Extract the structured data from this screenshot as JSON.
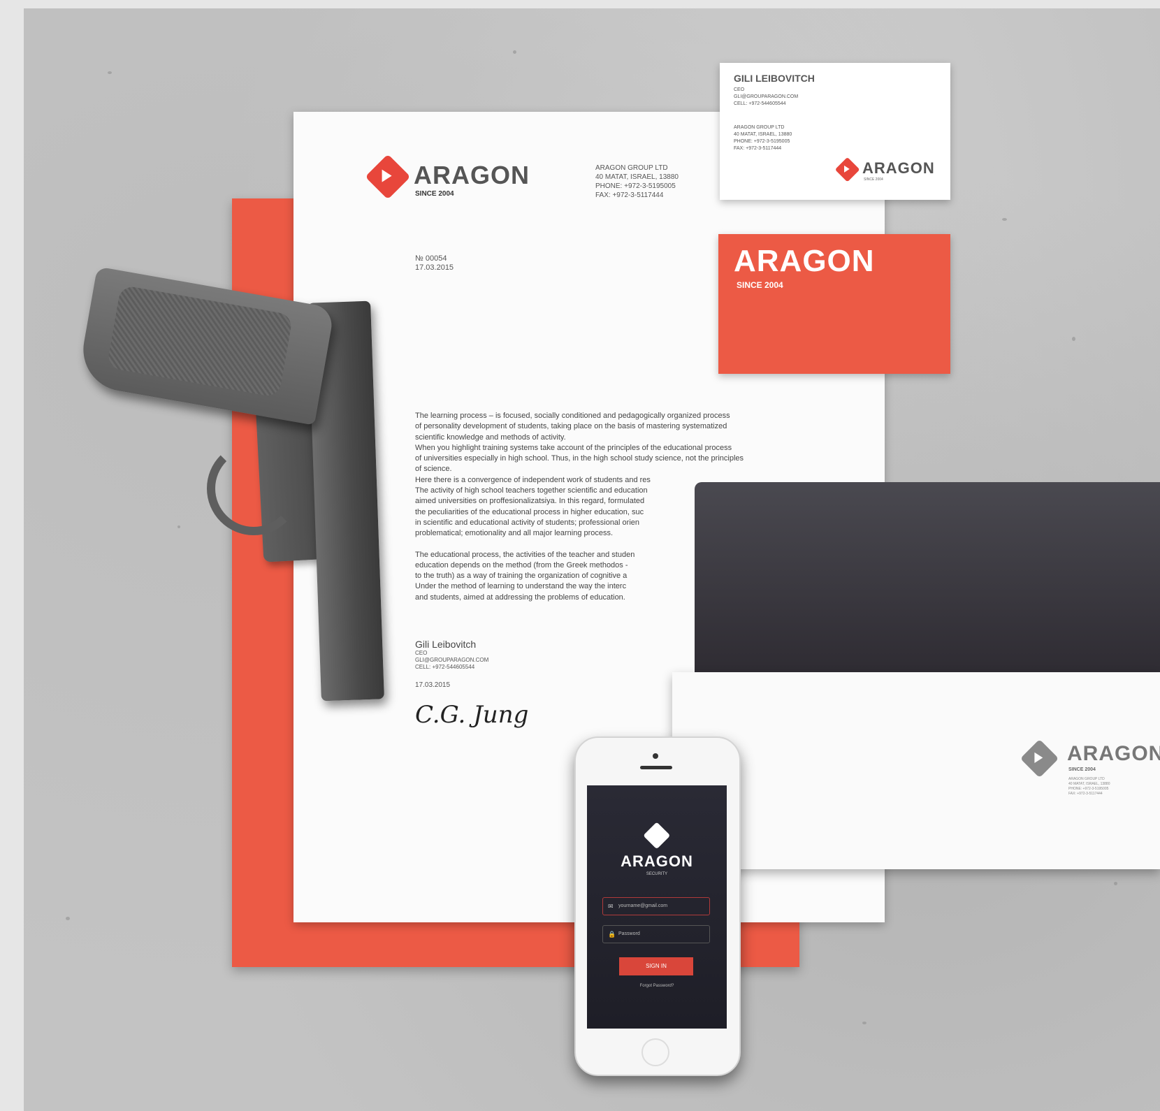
{
  "brand": {
    "name": "ARAGON",
    "since": "SINCE 2004",
    "accent": "#ec5a45"
  },
  "letterhead": {
    "company": [
      "ARAGON GROUP LTD",
      "40 MATAT, ISRAEL, 13880",
      "PHONE: +972-3-5195005",
      "FAX: +972-3-5117444"
    ],
    "ref_number": "№ 00054",
    "ref_date": "17.03.2015",
    "body": [
      "The learning process – is focused, socially conditioned and pedagogically organized process",
      "of personality development of students, taking place on the basis of mastering systematized",
      "scientific knowledge and methods of activity.",
      "When you highlight training systems take account of the principles of the educational process",
      "of universities especially in high school. Thus, in the high school study science, not the principles",
      "of science.",
      "Here there is a convergence of independent work of students and res",
      "The activity of high school teachers together scientific and education",
      "aimed universities on proffesionalizatsiya. In this regard, formulated",
      "the peculiarities of the educational process in higher education, suc",
      "in scientific and educational activity of students; professional orien",
      "problematical; emotionality and all major learning process.",
      "",
      "The educational process, the activities of the teacher and studen",
      "education depends on the method (from the Greek methodos -",
      "to the truth) as a way of training the organization of cognitive a",
      "Under the method of learning to understand the way the interc",
      "and students, aimed at addressing the problems of education."
    ],
    "signer_name": "Gili Leibovitch",
    "signer_title": "CEO",
    "signer_email": "GLI@GROUPARAGON.COM",
    "signer_cell": "CELL: +972-544605544",
    "sign_date": "17.03.2015",
    "signature": "C.G. Jung"
  },
  "business_card": {
    "name": "GILI LEIBOVITCH",
    "title": "CEO",
    "email": "GLI@GROUPARAGON.COM",
    "cell": "CELL: +972-544605544",
    "company_lines": [
      "ARAGON GROUP LTD",
      "40 MATAT, ISRAEL, 13880",
      "PHONE: +972-3-5195005",
      "FAX: +972-3-5117444"
    ],
    "since_small": "SINCE 2004"
  },
  "envelope": {
    "since": "SINCE 2004",
    "address": [
      "ARAGON GROUP LTD",
      "40 MATAT, ISRAEL, 13880",
      "PHONE: +972-3-5195005",
      "FAX: +972-3-5117444"
    ]
  },
  "phone_app": {
    "title": "ARAGON",
    "subtitle": "SECURITY",
    "email_placeholder": "yourname@gmail.com",
    "password_placeholder": "Password",
    "signin_label": "SIGN IN",
    "forgot_label": "Forgot Password?"
  }
}
